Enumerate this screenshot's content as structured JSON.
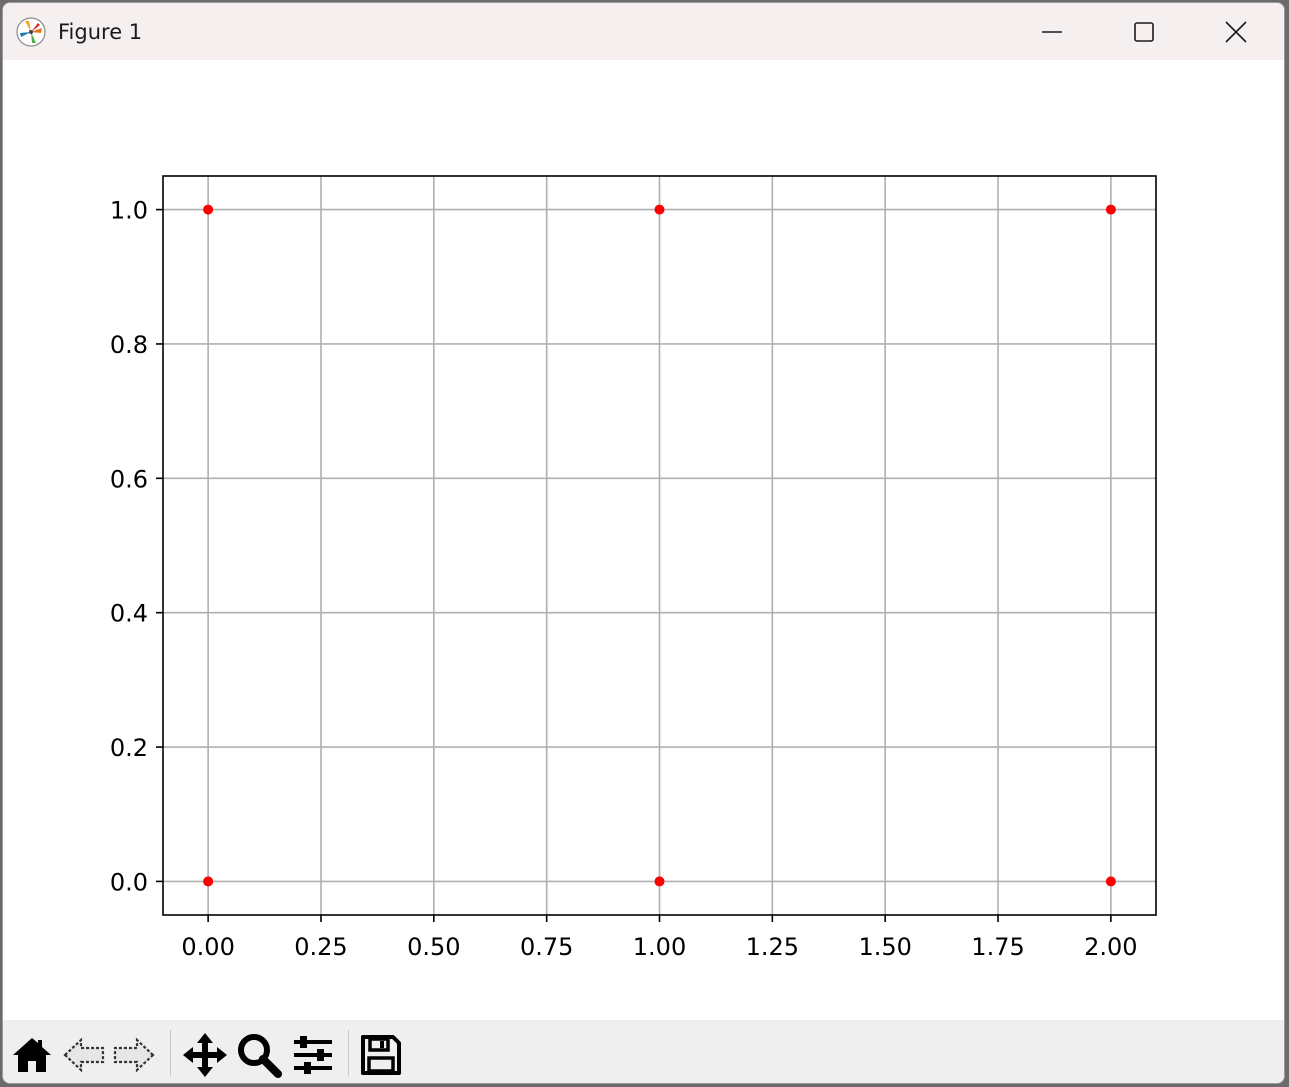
{
  "window": {
    "title": "Figure 1",
    "controls": [
      "minimize",
      "maximize",
      "close"
    ]
  },
  "toolbar": {
    "buttons": [
      {
        "name": "home",
        "icon": "home-icon"
      },
      {
        "name": "back",
        "icon": "back-arrow-icon"
      },
      {
        "name": "forward",
        "icon": "forward-arrow-icon"
      },
      {
        "name": "pan",
        "icon": "move-icon"
      },
      {
        "name": "zoom",
        "icon": "magnifier-icon"
      },
      {
        "name": "configure-subplots",
        "icon": "sliders-icon"
      },
      {
        "name": "save",
        "icon": "floppy-disk-icon"
      }
    ]
  },
  "chart_data": {
    "type": "scatter",
    "title": "",
    "xlabel": "",
    "ylabel": "",
    "x": [
      0,
      1,
      2,
      0,
      1,
      2
    ],
    "y": [
      0,
      0,
      0,
      1,
      1,
      1
    ],
    "xlim": [
      -0.1,
      2.1
    ],
    "ylim": [
      -0.05,
      1.05
    ],
    "xticks": [
      0,
      0.25,
      0.5,
      0.75,
      1,
      1.25,
      1.5,
      1.75,
      2
    ],
    "xtick_labels": [
      "0.00",
      "0.25",
      "0.50",
      "0.75",
      "1.00",
      "1.25",
      "1.50",
      "1.75",
      "2.00"
    ],
    "yticks": [
      0,
      0.2,
      0.4,
      0.6,
      0.8,
      1
    ],
    "ytick_labels": [
      "0.0",
      "0.2",
      "0.4",
      "0.6",
      "0.8",
      "1.0"
    ],
    "grid": true,
    "marker_color": "#ff0000",
    "grid_color": "#b0b0b0"
  }
}
